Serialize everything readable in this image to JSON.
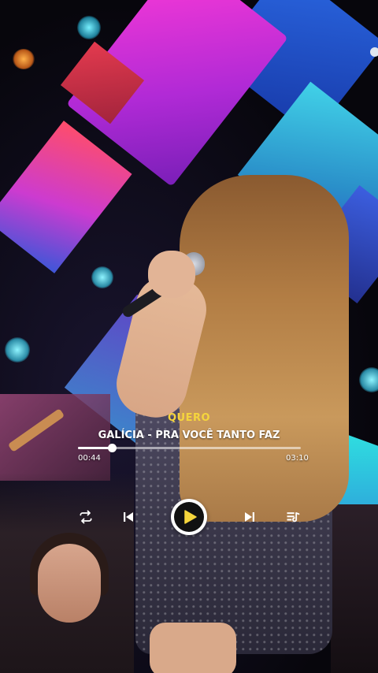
{
  "player": {
    "artist_label": "QUERO",
    "song_title": "GALÍCIA - PRA VOCÊ TANTO FAZ",
    "current_time": "00:44",
    "total_time": "03:10",
    "progress_fraction": 0.152,
    "is_playing": false
  },
  "controls": {
    "repeat": "repeat-icon",
    "previous": "skip-previous-icon",
    "play": "play-icon",
    "next": "skip-next-icon",
    "playlist": "playlist-icon"
  },
  "colors": {
    "accent": "#f5d53c",
    "text": "#ffffff",
    "track_bg": "#bfbfbf"
  }
}
